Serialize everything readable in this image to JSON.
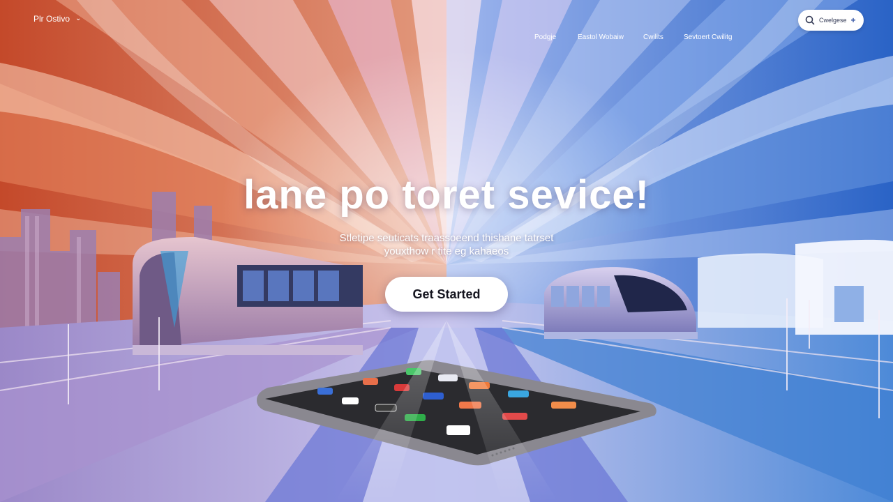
{
  "brand": {
    "label": "Plr Ostivo"
  },
  "nav": {
    "items": [
      {
        "label": "Podgje"
      },
      {
        "label": "Eastol  Wobaiw"
      },
      {
        "label": "Cwilits"
      },
      {
        "label": "Sevtoert  Cwilitg"
      }
    ]
  },
  "search": {
    "label": "Cwelgese"
  },
  "hero": {
    "headline": "lane po toret sevice!",
    "sub_line1": "Stletipe seuticats traassoeend thishane tatrset",
    "sub_line2": "youxthow r tite eg kahaeos",
    "cta_label": "Get Started"
  },
  "colors": {
    "warm_left": "#c8522b",
    "center_pink": "#c89ac2",
    "cool_right": "#2f6fcf",
    "cta_bg": "#ffffff",
    "tablet_body": "#3a3a3a"
  },
  "icons": [
    "chevron-down-icon",
    "search-icon",
    "plus-icon"
  ]
}
